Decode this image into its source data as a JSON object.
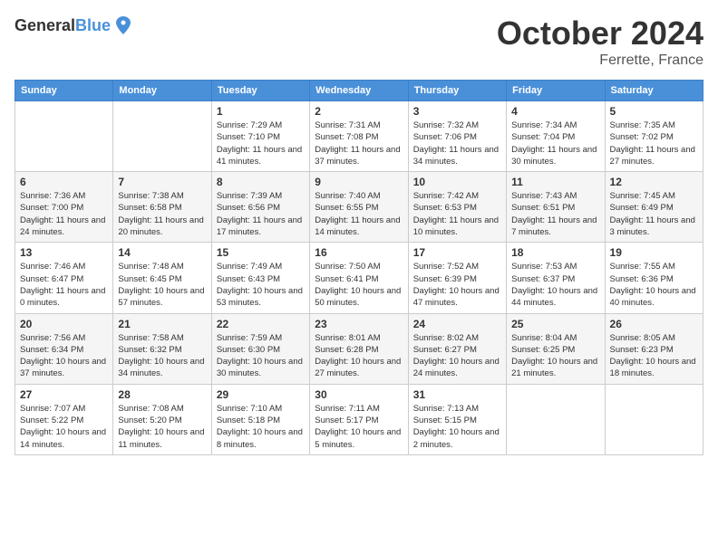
{
  "logo": {
    "general": "General",
    "blue": "Blue"
  },
  "title": "October 2024",
  "location": "Ferrette, France",
  "days_of_week": [
    "Sunday",
    "Monday",
    "Tuesday",
    "Wednesday",
    "Thursday",
    "Friday",
    "Saturday"
  ],
  "weeks": [
    [
      {
        "day": "",
        "sunrise": "",
        "sunset": "",
        "daylight": ""
      },
      {
        "day": "",
        "sunrise": "",
        "sunset": "",
        "daylight": ""
      },
      {
        "day": "1",
        "sunrise": "Sunrise: 7:29 AM",
        "sunset": "Sunset: 7:10 PM",
        "daylight": "Daylight: 11 hours and 41 minutes."
      },
      {
        "day": "2",
        "sunrise": "Sunrise: 7:31 AM",
        "sunset": "Sunset: 7:08 PM",
        "daylight": "Daylight: 11 hours and 37 minutes."
      },
      {
        "day": "3",
        "sunrise": "Sunrise: 7:32 AM",
        "sunset": "Sunset: 7:06 PM",
        "daylight": "Daylight: 11 hours and 34 minutes."
      },
      {
        "day": "4",
        "sunrise": "Sunrise: 7:34 AM",
        "sunset": "Sunset: 7:04 PM",
        "daylight": "Daylight: 11 hours and 30 minutes."
      },
      {
        "day": "5",
        "sunrise": "Sunrise: 7:35 AM",
        "sunset": "Sunset: 7:02 PM",
        "daylight": "Daylight: 11 hours and 27 minutes."
      }
    ],
    [
      {
        "day": "6",
        "sunrise": "Sunrise: 7:36 AM",
        "sunset": "Sunset: 7:00 PM",
        "daylight": "Daylight: 11 hours and 24 minutes."
      },
      {
        "day": "7",
        "sunrise": "Sunrise: 7:38 AM",
        "sunset": "Sunset: 6:58 PM",
        "daylight": "Daylight: 11 hours and 20 minutes."
      },
      {
        "day": "8",
        "sunrise": "Sunrise: 7:39 AM",
        "sunset": "Sunset: 6:56 PM",
        "daylight": "Daylight: 11 hours and 17 minutes."
      },
      {
        "day": "9",
        "sunrise": "Sunrise: 7:40 AM",
        "sunset": "Sunset: 6:55 PM",
        "daylight": "Daylight: 11 hours and 14 minutes."
      },
      {
        "day": "10",
        "sunrise": "Sunrise: 7:42 AM",
        "sunset": "Sunset: 6:53 PM",
        "daylight": "Daylight: 11 hours and 10 minutes."
      },
      {
        "day": "11",
        "sunrise": "Sunrise: 7:43 AM",
        "sunset": "Sunset: 6:51 PM",
        "daylight": "Daylight: 11 hours and 7 minutes."
      },
      {
        "day": "12",
        "sunrise": "Sunrise: 7:45 AM",
        "sunset": "Sunset: 6:49 PM",
        "daylight": "Daylight: 11 hours and 3 minutes."
      }
    ],
    [
      {
        "day": "13",
        "sunrise": "Sunrise: 7:46 AM",
        "sunset": "Sunset: 6:47 PM",
        "daylight": "Daylight: 11 hours and 0 minutes."
      },
      {
        "day": "14",
        "sunrise": "Sunrise: 7:48 AM",
        "sunset": "Sunset: 6:45 PM",
        "daylight": "Daylight: 10 hours and 57 minutes."
      },
      {
        "day": "15",
        "sunrise": "Sunrise: 7:49 AM",
        "sunset": "Sunset: 6:43 PM",
        "daylight": "Daylight: 10 hours and 53 minutes."
      },
      {
        "day": "16",
        "sunrise": "Sunrise: 7:50 AM",
        "sunset": "Sunset: 6:41 PM",
        "daylight": "Daylight: 10 hours and 50 minutes."
      },
      {
        "day": "17",
        "sunrise": "Sunrise: 7:52 AM",
        "sunset": "Sunset: 6:39 PM",
        "daylight": "Daylight: 10 hours and 47 minutes."
      },
      {
        "day": "18",
        "sunrise": "Sunrise: 7:53 AM",
        "sunset": "Sunset: 6:37 PM",
        "daylight": "Daylight: 10 hours and 44 minutes."
      },
      {
        "day": "19",
        "sunrise": "Sunrise: 7:55 AM",
        "sunset": "Sunset: 6:36 PM",
        "daylight": "Daylight: 10 hours and 40 minutes."
      }
    ],
    [
      {
        "day": "20",
        "sunrise": "Sunrise: 7:56 AM",
        "sunset": "Sunset: 6:34 PM",
        "daylight": "Daylight: 10 hours and 37 minutes."
      },
      {
        "day": "21",
        "sunrise": "Sunrise: 7:58 AM",
        "sunset": "Sunset: 6:32 PM",
        "daylight": "Daylight: 10 hours and 34 minutes."
      },
      {
        "day": "22",
        "sunrise": "Sunrise: 7:59 AM",
        "sunset": "Sunset: 6:30 PM",
        "daylight": "Daylight: 10 hours and 30 minutes."
      },
      {
        "day": "23",
        "sunrise": "Sunrise: 8:01 AM",
        "sunset": "Sunset: 6:28 PM",
        "daylight": "Daylight: 10 hours and 27 minutes."
      },
      {
        "day": "24",
        "sunrise": "Sunrise: 8:02 AM",
        "sunset": "Sunset: 6:27 PM",
        "daylight": "Daylight: 10 hours and 24 minutes."
      },
      {
        "day": "25",
        "sunrise": "Sunrise: 8:04 AM",
        "sunset": "Sunset: 6:25 PM",
        "daylight": "Daylight: 10 hours and 21 minutes."
      },
      {
        "day": "26",
        "sunrise": "Sunrise: 8:05 AM",
        "sunset": "Sunset: 6:23 PM",
        "daylight": "Daylight: 10 hours and 18 minutes."
      }
    ],
    [
      {
        "day": "27",
        "sunrise": "Sunrise: 7:07 AM",
        "sunset": "Sunset: 5:22 PM",
        "daylight": "Daylight: 10 hours and 14 minutes."
      },
      {
        "day": "28",
        "sunrise": "Sunrise: 7:08 AM",
        "sunset": "Sunset: 5:20 PM",
        "daylight": "Daylight: 10 hours and 11 minutes."
      },
      {
        "day": "29",
        "sunrise": "Sunrise: 7:10 AM",
        "sunset": "Sunset: 5:18 PM",
        "daylight": "Daylight: 10 hours and 8 minutes."
      },
      {
        "day": "30",
        "sunrise": "Sunrise: 7:11 AM",
        "sunset": "Sunset: 5:17 PM",
        "daylight": "Daylight: 10 hours and 5 minutes."
      },
      {
        "day": "31",
        "sunrise": "Sunrise: 7:13 AM",
        "sunset": "Sunset: 5:15 PM",
        "daylight": "Daylight: 10 hours and 2 minutes."
      },
      {
        "day": "",
        "sunrise": "",
        "sunset": "",
        "daylight": ""
      },
      {
        "day": "",
        "sunrise": "",
        "sunset": "",
        "daylight": ""
      }
    ]
  ]
}
